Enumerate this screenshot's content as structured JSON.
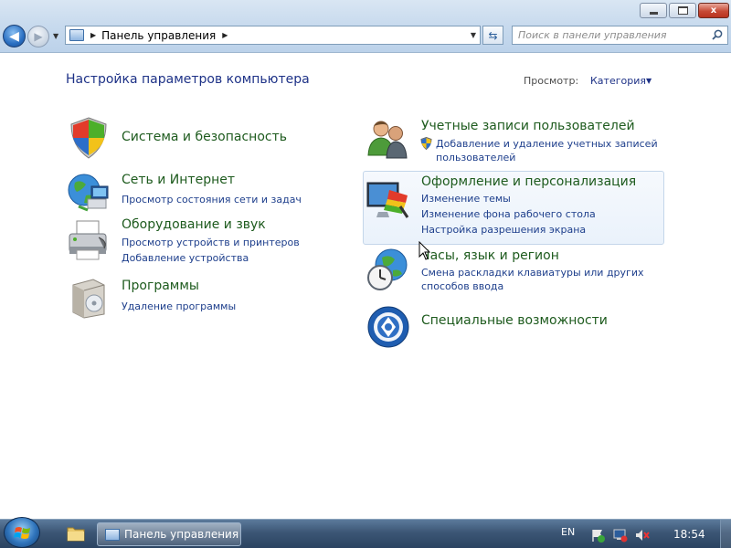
{
  "window": {
    "minimize_label": "",
    "maximize_label": "",
    "close_label": "x"
  },
  "address_bar": {
    "breadcrumb": "Панель управления"
  },
  "search": {
    "placeholder": "Поиск в панели управления"
  },
  "header": {
    "title": "Настройка параметров компьютера",
    "view_label": "Просмотр:",
    "view_value": "Категория"
  },
  "categories": [
    {
      "title": "Система и безопасность",
      "icon": "shield-icon",
      "links": []
    },
    {
      "title": "Сеть и Интернет",
      "icon": "network-globe-icon",
      "links": [
        "Просмотр состояния сети и задач"
      ]
    },
    {
      "title": "Оборудование и звук",
      "icon": "printer-icon",
      "links": [
        "Просмотр устройств и принтеров",
        "Добавление устройства"
      ]
    },
    {
      "title": "Программы",
      "icon": "programs-box-icon",
      "links": [
        "Удаление программы"
      ]
    },
    {
      "title": "Учетные записи пользователей",
      "icon": "users-icon",
      "links": [
        "Добавление и удаление учетных записей",
        "пользователей"
      ]
    },
    {
      "title": "Оформление и персонализация",
      "icon": "display-color-icon",
      "links": [
        "Изменение темы",
        "Изменение фона рабочего стола",
        "Настройка разрешения экрана"
      ]
    },
    {
      "title": "Часы, язык и регион",
      "icon": "clock-globe-icon",
      "links": [
        "Смена раскладки клавиатуры или других",
        "способов ввода"
      ]
    },
    {
      "title": "Специальные возможности",
      "icon": "accessibility-icon",
      "links": []
    }
  ],
  "taskbar": {
    "task_label": "Панель управления",
    "language": "EN",
    "time": "18:54"
  }
}
